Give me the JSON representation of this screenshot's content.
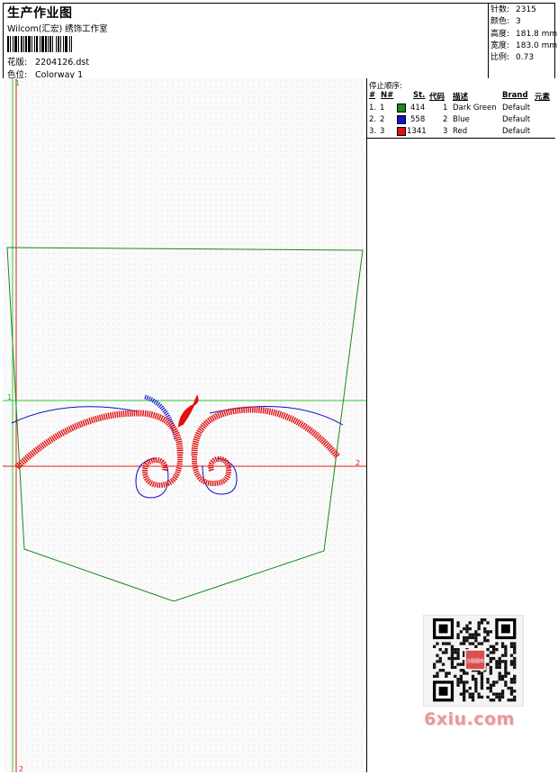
{
  "header": {
    "title": "生产作业图",
    "company": "Wilcom(汇宏) 绣饰工作室",
    "design_label": "花版:",
    "design_value": "2204126.dst",
    "colorway_label": "色位:",
    "colorway_value": "Colorway 1"
  },
  "stats": {
    "stitches_label": "针数:",
    "stitches_value": "2315",
    "colors_label": "颜色:",
    "colors_value": "3",
    "height_label": "高度:",
    "height_value": "181.8 mm",
    "width_label": "宽度:",
    "width_value": "183.0 mm",
    "scale_label": "比例:",
    "scale_value": "0.73"
  },
  "sequence": {
    "title": "停止顺序:",
    "headers": {
      "hash": "#",
      "no": "N#",
      "stitches": "St.",
      "code": "代码",
      "description": "描述",
      "brand": "Brand",
      "element": "元素"
    },
    "threads": [
      {
        "stop": "1.",
        "no": "1",
        "stitches": "414",
        "code": "1",
        "description": "Dark Green",
        "brand": "Default",
        "color": "#1a8a1a"
      },
      {
        "stop": "2.",
        "no": "2",
        "stitches": "558",
        "code": "2",
        "description": "Blue",
        "brand": "Default",
        "color": "#1010d0"
      },
      {
        "stop": "3.",
        "no": "3",
        "stitches": "1341",
        "code": "3",
        "description": "Red",
        "brand": "Default",
        "color": "#e01010"
      }
    ]
  },
  "canvas": {
    "marker_top_1": "1",
    "marker_left_1": "1",
    "marker_right_2": "2",
    "marker_bottom_2": "2"
  },
  "watermark": {
    "text": "6xiu.com",
    "badge": "汉服图库"
  },
  "colors": {
    "outline": "#1a8a1a",
    "blue": "#1010d0",
    "red": "#e01010",
    "guide_green": "#33cc33",
    "guide_red": "#e02020"
  }
}
